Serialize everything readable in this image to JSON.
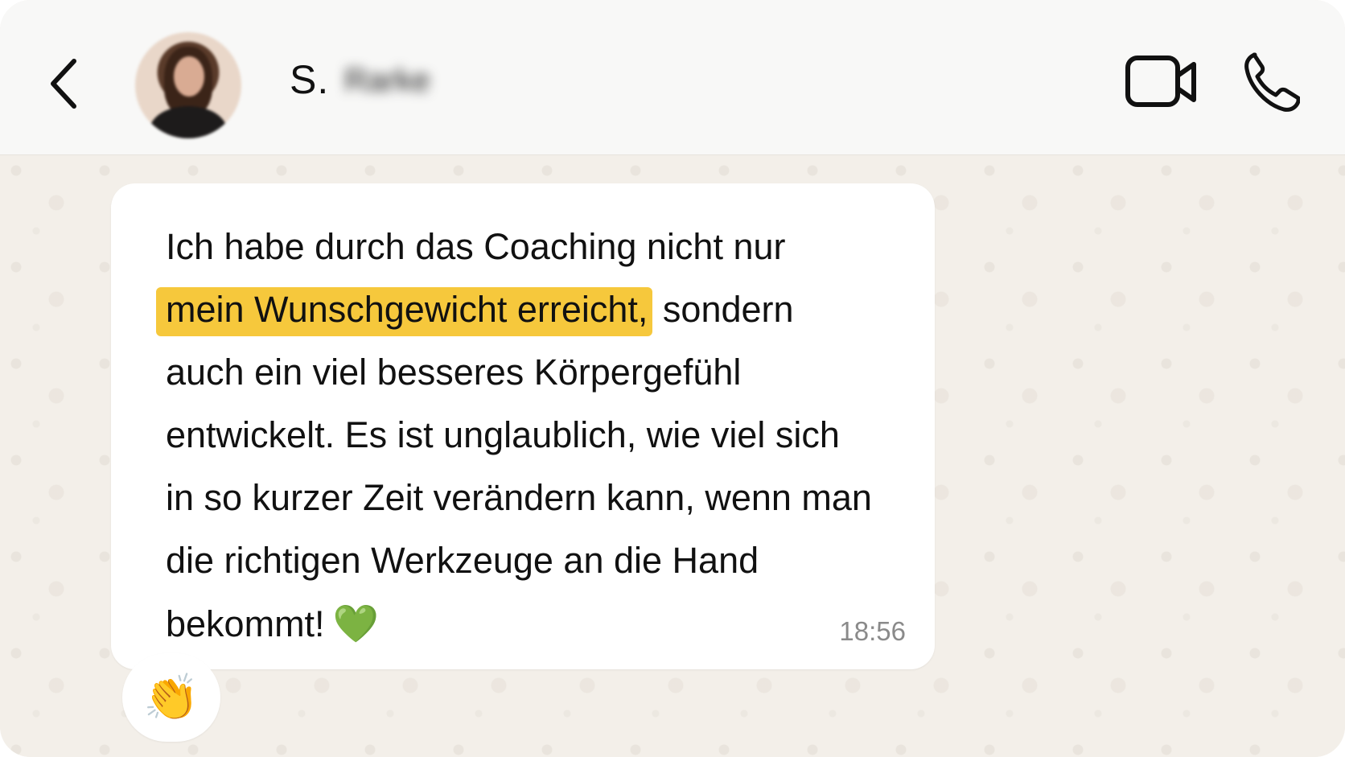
{
  "header": {
    "contact_initial": "S.",
    "contact_surname_blurred": "Rarke",
    "back_icon": "chevron-left-icon",
    "video_icon": "video-camera-icon",
    "call_icon": "phone-icon"
  },
  "message": {
    "before_highlight": "Ich habe durch das Coaching nicht nur ",
    "highlight": "mein Wunschgewicht erreicht,",
    "after_highlight": " sondern auch ein viel besseres Körpergefühl entwickelt. Es ist unglaublich, wie viel sich in so kurzer Zeit verändern kann, wenn man die richtigen Werkzeuge an die Hand bekommt!",
    "emoji": "💚",
    "time": "18:56",
    "highlight_color": "#f6c83c"
  },
  "reaction": {
    "emoji": "👏"
  }
}
